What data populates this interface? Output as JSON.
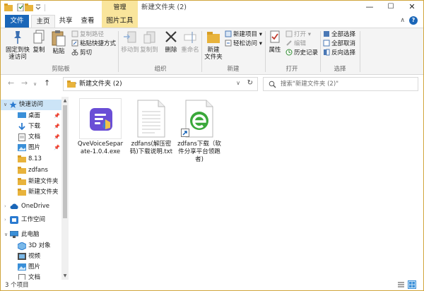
{
  "titlebar": {
    "title": "新建文件夹 (2)",
    "context_tab": "管理",
    "minimize": "—",
    "maximize": "☐",
    "close": "✕"
  },
  "ribbon_tabs": {
    "file": "文件",
    "home": "主页",
    "share": "共享",
    "view": "查看",
    "picture_tools": "图片工具"
  },
  "ribbon": {
    "clipboard": {
      "label": "剪贴板",
      "pin_quick_line1": "固定到快",
      "pin_quick_line2": "速访问",
      "copy": "复制",
      "paste": "粘贴",
      "copy_path": "复制路径",
      "paste_shortcut": "粘贴快捷方式",
      "cut": "剪切"
    },
    "organize": {
      "label": "组织",
      "move_to": "移动到",
      "copy_to": "复制到",
      "delete": "删除",
      "rename": "重命名"
    },
    "new": {
      "label": "新建",
      "new_folder_line1": "新建",
      "new_folder_line2": "文件夹",
      "new_item": "新建项目",
      "easy_access": "轻松访问"
    },
    "open": {
      "label": "打开",
      "properties": "属性",
      "open": "打开",
      "edit": "编辑",
      "history": "历史记录"
    },
    "select": {
      "label": "选择",
      "select_all": "全部选择",
      "select_none": "全部取消",
      "invert": "反向选择"
    }
  },
  "address": {
    "path": "新建文件夹 (2)",
    "search_placeholder": "搜索\"新建文件夹 (2)\""
  },
  "nav": {
    "quick_access": "快速访问",
    "items": [
      "桌面",
      "下载",
      "文档",
      "图片",
      "8.13",
      "zdfans",
      "新建文件夹",
      "新建文件夹"
    ],
    "onedrive": "OneDrive",
    "workspace": "工作空间",
    "this_pc": "此电脑",
    "pc_items": [
      "3D 对象",
      "视频",
      "图片",
      "文档"
    ]
  },
  "files": [
    {
      "name": "QveVoiceSeparate-1.0.4.exe",
      "type": "exe"
    },
    {
      "name": "zdfans(解压密码)下载说明.txt",
      "type": "txt"
    },
    {
      "name": "zdfans下载（软件分享平台领跑者)",
      "type": "shortcut"
    }
  ],
  "status": {
    "text": "3 个项目"
  },
  "colors": {
    "accent_blue": "#1a66b8",
    "context_tab": "#f9e59c",
    "selection": "#cce4f7",
    "frame": "#d0a53b"
  }
}
